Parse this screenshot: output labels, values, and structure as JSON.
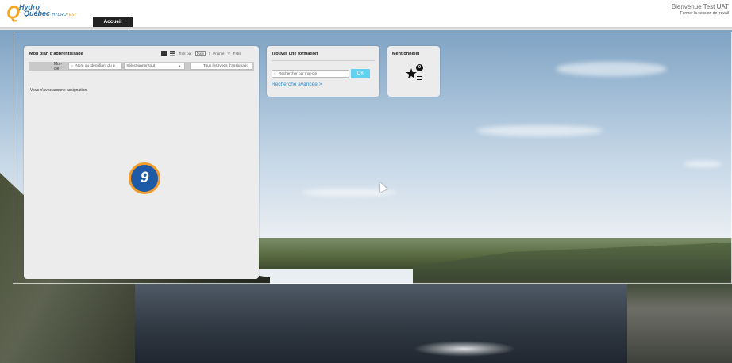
{
  "header": {
    "logo": {
      "line1": "Hydro",
      "line2": "Québec",
      "env_small": "HYDRO",
      "env_test": "TEST"
    },
    "active_tab": "Accueil",
    "welcome": "Bienvenue Test UAT",
    "logout": "Fermer la session de travail"
  },
  "plan_panel": {
    "title": "Mon plan d'apprentissage",
    "sort_label": "Trier par",
    "sort_date": "Date",
    "sort_priority": "Priorité",
    "filter_label": "Filtre",
    "keyword_label": "Mot-clé",
    "keyword_placeholder": "Nom ou identifiant du p",
    "select_all": "Sélectionner tout",
    "types_label": "Tous les types d'assignatio",
    "empty_message": "Vous n'avez aucune assignation"
  },
  "find_panel": {
    "title": "Trouver une formation",
    "search_placeholder": "Rechercher par mot-clé",
    "ok_label": "OK",
    "advanced_link": "Recherche avancée >"
  },
  "mentions_panel": {
    "title": "Mentionné(e)",
    "count": "0"
  },
  "step_badge": "9",
  "icons": [
    "grid-view-icon",
    "list-view-icon",
    "filter-icon",
    "search-icon",
    "star-list-icon",
    "mouse-cursor-icon"
  ],
  "colors": {
    "brand_orange": "#f5a623",
    "brand_blue": "#2a6fa8",
    "ok_button": "#63d1f0",
    "link": "#2a8ccf",
    "badge_blue": "#1f5aa6",
    "badge_ring": "#f39c2b"
  }
}
